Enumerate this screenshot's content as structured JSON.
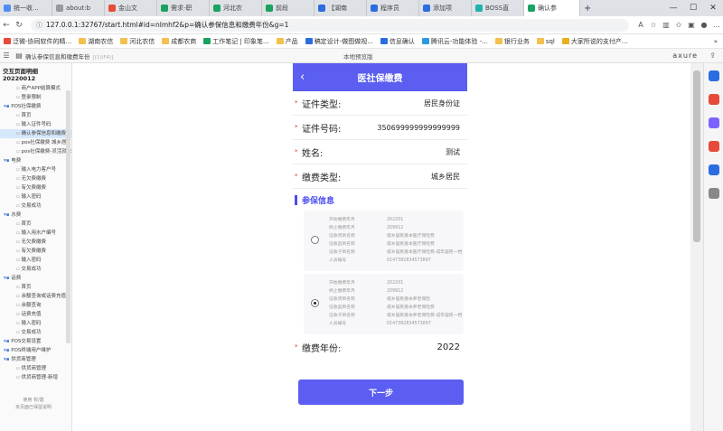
{
  "browser": {
    "tabs": [
      {
        "label": "统一收...",
        "color": "#4f8df5",
        "active": false
      },
      {
        "label": "about:b",
        "color": "#999999",
        "active": false
      },
      {
        "label": "金山文",
        "color": "#e84a3a",
        "active": false
      },
      {
        "label": "需求-职",
        "color": "#1aa260",
        "active": false
      },
      {
        "label": "河北农",
        "color": "#1aa260",
        "active": false
      },
      {
        "label": "前段",
        "color": "#1aa260",
        "active": false
      },
      {
        "label": "【湖南",
        "color": "#2b6de0",
        "active": false
      },
      {
        "label": "程序员",
        "color": "#2b6de0",
        "active": false
      },
      {
        "label": "添加项",
        "color": "#2b6de0",
        "active": false
      },
      {
        "label": "BOSS直",
        "color": "#20b2aa",
        "active": false
      },
      {
        "label": "确认参",
        "color": "#1aa260",
        "active": true
      }
    ],
    "url": "127.0.0.1:32767/start.html#id=nlmhf2&p=确认参保信息和缴费年份&g=1",
    "bookmarks": [
      {
        "label": "泛微-协同软件的精...",
        "color": "#e84a3a"
      },
      {
        "label": "湖南农信",
        "color": "#f2c14e"
      },
      {
        "label": "河北农信",
        "color": "#f2c14e"
      },
      {
        "label": "成都农商",
        "color": "#f2c14e"
      },
      {
        "label": "工作笔记 | 印象笔...",
        "color": "#1aa260"
      },
      {
        "label": "产品",
        "color": "#f2c14e"
      },
      {
        "label": "稿定设计-做图做视...",
        "color": "#2b6de0"
      },
      {
        "label": "信息确认",
        "color": "#2b6de0"
      },
      {
        "label": "腾讯云-功能体验 -...",
        "color": "#2b9be0"
      },
      {
        "label": "银行业务",
        "color": "#f2c14e"
      },
      {
        "label": "sql",
        "color": "#f2c14e"
      },
      {
        "label": "大家所说的支付产...",
        "color": "#e8b020"
      }
    ],
    "bookmarks_more": "»"
  },
  "axure": {
    "page_name": "确认参保信息和缴费年份",
    "page_tag": "[(1)(F4)]",
    "center_label": "本地预览版",
    "brand": "axure",
    "project": "交互页面明细20220012",
    "tree": [
      {
        "label": "商户APP结算模式",
        "type": "page"
      },
      {
        "label": "登录限制",
        "type": "page"
      },
      {
        "label": "POS社保缴费",
        "type": "folder"
      },
      {
        "label": "首页",
        "type": "page"
      },
      {
        "label": "输入证件号码",
        "type": "page"
      },
      {
        "label": "确认参保信息和缴费年",
        "type": "page",
        "selected": true
      },
      {
        "label": "pos社保缴费 城乡居",
        "type": "page"
      },
      {
        "label": "pos社保缴费-灵活就业",
        "type": "page"
      },
      {
        "label": "电费",
        "type": "folder"
      },
      {
        "label": "输入电力客户号",
        "type": "page"
      },
      {
        "label": "无欠费缴费",
        "type": "page"
      },
      {
        "label": "有欠费缴费",
        "type": "page"
      },
      {
        "label": "输入密码",
        "type": "page"
      },
      {
        "label": "交易成功",
        "type": "page"
      },
      {
        "label": "水费",
        "type": "folder"
      },
      {
        "label": "首页",
        "type": "page"
      },
      {
        "label": "输入用水户编号",
        "type": "page"
      },
      {
        "label": "无欠费缴费",
        "type": "page"
      },
      {
        "label": "有欠费缴费",
        "type": "page"
      },
      {
        "label": "输入密码",
        "type": "page"
      },
      {
        "label": "交易成功",
        "type": "page"
      },
      {
        "label": "话费",
        "type": "folder"
      },
      {
        "label": "首页",
        "type": "page"
      },
      {
        "label": "余额查询或话费充值",
        "type": "page"
      },
      {
        "label": "余额查询",
        "type": "page"
      },
      {
        "label": "话费充值",
        "type": "page"
      },
      {
        "label": "输入密码",
        "type": "page"
      },
      {
        "label": "交易成功",
        "type": "page"
      },
      {
        "label": "POS交易设置",
        "type": "folder"
      },
      {
        "label": "POS终端用户维护",
        "type": "folder"
      },
      {
        "label": "供货商管理",
        "type": "folder"
      },
      {
        "label": "供货商管理",
        "type": "page"
      },
      {
        "label": "供货商管理-新增",
        "type": "page"
      }
    ],
    "footer_line1": "使用 权/建",
    "footer_line2": "京页面已保留说明"
  },
  "app": {
    "header_title": "医社保缴费",
    "fields": [
      {
        "label": "证件类型:",
        "value": "居民身份证"
      },
      {
        "label": "证件号码:",
        "value": "350699999999999999"
      },
      {
        "label": "姓名:",
        "value": "测试"
      },
      {
        "label": "缴费类型:",
        "value": "城乡居民"
      }
    ],
    "section_title": "参保信息",
    "cards": [
      {
        "selected": false,
        "rows": [
          {
            "k": "开始缴费年月",
            "v": "202201"
          },
          {
            "k": "终止缴费年月",
            "v": "209912"
          },
          {
            "k": "征收项目名称",
            "v": "城乡居民基本医疗保险费"
          },
          {
            "k": "征收品目名称",
            "v": "城乡居民基本医疗保险费"
          },
          {
            "k": "征收子目名称",
            "v": "城乡居民基本医疗保险费-成年居民一档"
          },
          {
            "k": "人员编号",
            "v": "0147382834573897"
          }
        ]
      },
      {
        "selected": true,
        "rows": [
          {
            "k": "开始缴费年月",
            "v": "202201"
          },
          {
            "k": "终止缴费年月",
            "v": "209912"
          },
          {
            "k": "征收项目名称",
            "v": "城乡居民基本养老保险"
          },
          {
            "k": "征收品目名称",
            "v": "城乡居民基本养老保险费"
          },
          {
            "k": "征收子目名称",
            "v": "城乡居民基本养老保险费-成年居民一档"
          },
          {
            "k": "人员编号",
            "v": "0147382834573897"
          }
        ]
      }
    ],
    "year_label": "缴费年份:",
    "year_value": "2022",
    "next_button": "下一步"
  },
  "edge_icons": [
    {
      "name": "search-icon",
      "color": "#2b6de0"
    },
    {
      "name": "collections-icon",
      "color": "#e84a3a"
    },
    {
      "name": "games-icon",
      "color": "#7b61ff"
    },
    {
      "name": "office-icon",
      "color": "#e84a3a"
    },
    {
      "name": "outlook-icon",
      "color": "#2b6de0"
    },
    {
      "name": "add-icon",
      "color": "#888888"
    }
  ]
}
